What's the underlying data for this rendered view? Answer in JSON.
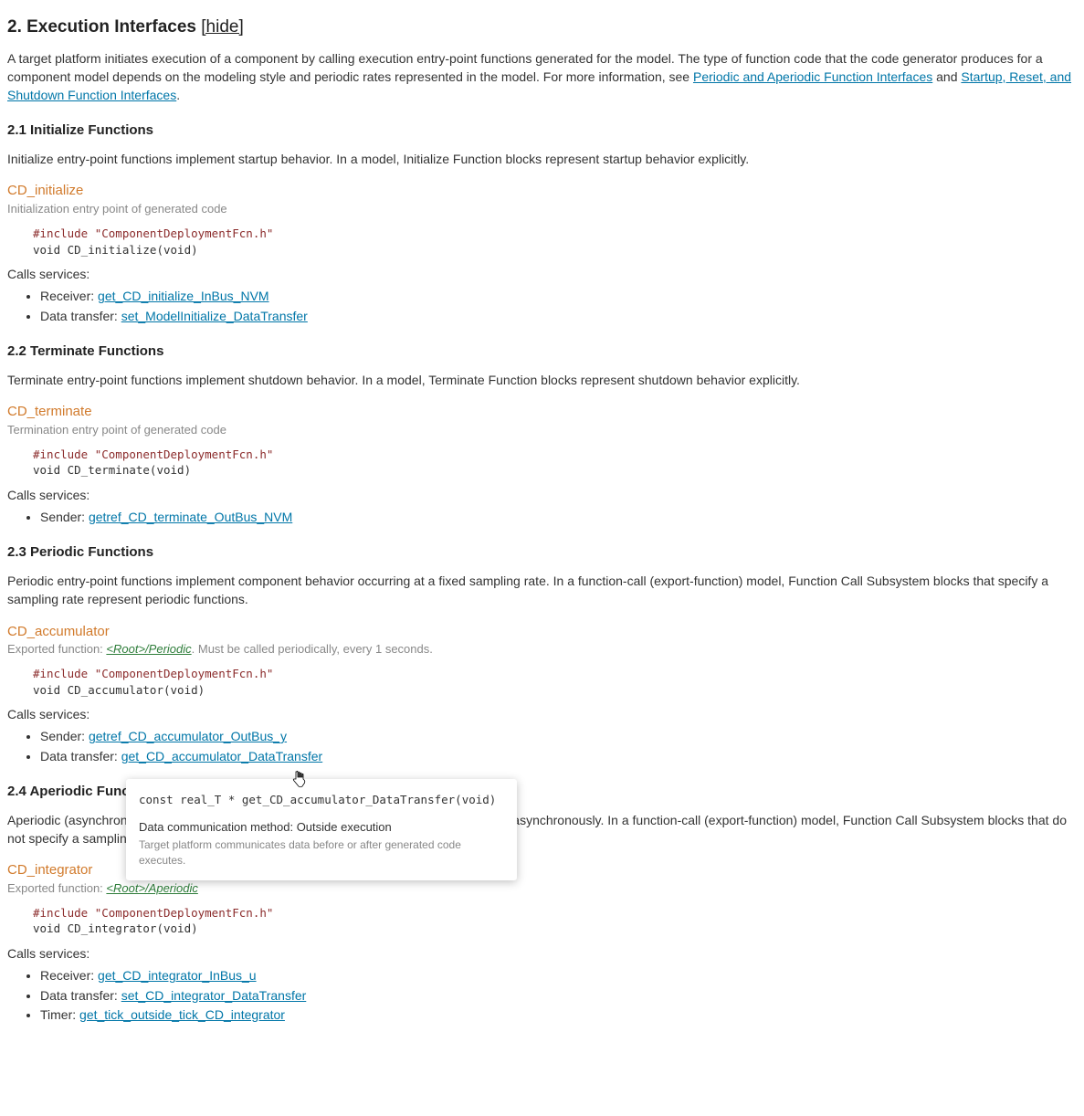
{
  "section": {
    "title": "2. Execution Interfaces",
    "hide_label": "[hide]",
    "intro_a": "A target platform initiates execution of a component by calling execution entry-point functions generated for the model. The type of function code that the code generator produces for a component model depends on the modeling style and periodic rates represented in the model. For more information, see ",
    "intro_link1": "Periodic and Aperiodic Function Interfaces",
    "intro_b": " and ",
    "intro_link2": "Startup, Reset, and Shutdown Function Interfaces",
    "intro_c": "."
  },
  "s21": {
    "title": "2.1 Initialize Functions",
    "desc": "Initialize entry-point functions implement startup behavior. In a model, Initialize Function blocks represent startup behavior explicitly.",
    "fn_name": "CD_initialize",
    "fn_desc": "Initialization entry point of generated code",
    "code_inc": "#include \"ComponentDeploymentFcn.h\"",
    "code_sig": "void CD_initialize(void)",
    "calls_label": "Calls services:",
    "svc1_label": "Receiver: ",
    "svc1_link": "get_CD_initialize_InBus_NVM",
    "svc2_label": "Data transfer: ",
    "svc2_link": "set_ModelInitialize_DataTransfer"
  },
  "s22": {
    "title": "2.2 Terminate Functions",
    "desc": "Terminate entry-point functions implement shutdown behavior. In a model, Terminate Function blocks represent shutdown behavior explicitly.",
    "fn_name": "CD_terminate",
    "fn_desc": "Termination entry point of generated code",
    "code_inc": "#include \"ComponentDeploymentFcn.h\"",
    "code_sig": "void CD_terminate(void)",
    "calls_label": "Calls services:",
    "svc1_label": "Sender: ",
    "svc1_link": "getref_CD_terminate_OutBus_NVM"
  },
  "s23": {
    "title": "2.3 Periodic Functions",
    "desc": "Periodic entry-point functions implement component behavior occurring at a fixed sampling rate. In a function-call (export-function) model, Function Call Subsystem blocks that specify a sampling rate represent periodic functions.",
    "fn_name": "CD_accumulator",
    "fn_desc_a": "Exported function: ",
    "fn_desc_link": "<Root>/Periodic",
    "fn_desc_b": ". Must be called periodically, every 1 seconds.",
    "code_inc": "#include \"ComponentDeploymentFcn.h\"",
    "code_sig": "void CD_accumulator(void)",
    "calls_label": "Calls services:",
    "svc1_label": "Sender: ",
    "svc1_link": "getref_CD_accumulator_OutBus_y",
    "svc2_label": "Data transfer: ",
    "svc2_link": "get_CD_accumulator_DataTransfer"
  },
  "s24": {
    "title": "2.4 Aperiodic Functions",
    "desc": "Aperiodic (asynchronous) entry-point functions implement component behavior occurring asynchronously. In a function-call (export-function) model, Function Call Subsystem blocks that do not specify a sampling rate represent aperiodic functions.",
    "fn_name": "CD_integrator",
    "fn_desc_a": "Exported function: ",
    "fn_desc_link": "<Root>/Aperiodic",
    "code_inc": "#include \"ComponentDeploymentFcn.h\"",
    "code_sig": "void CD_integrator(void)",
    "calls_label": "Calls services:",
    "svc1_label": "Receiver: ",
    "svc1_link": "get_CD_integrator_InBus_u",
    "svc2_label": "Data transfer: ",
    "svc2_link": "set_CD_integrator_DataTransfer",
    "svc3_label": "Timer: ",
    "svc3_link": "get_tick_outside_tick_CD_integrator"
  },
  "tooltip": {
    "sig": "const real_T * get_CD_accumulator_DataTransfer(void)",
    "line1": "Data communication method: Outside execution",
    "line2": "Target platform communicates data before or after generated code executes."
  }
}
